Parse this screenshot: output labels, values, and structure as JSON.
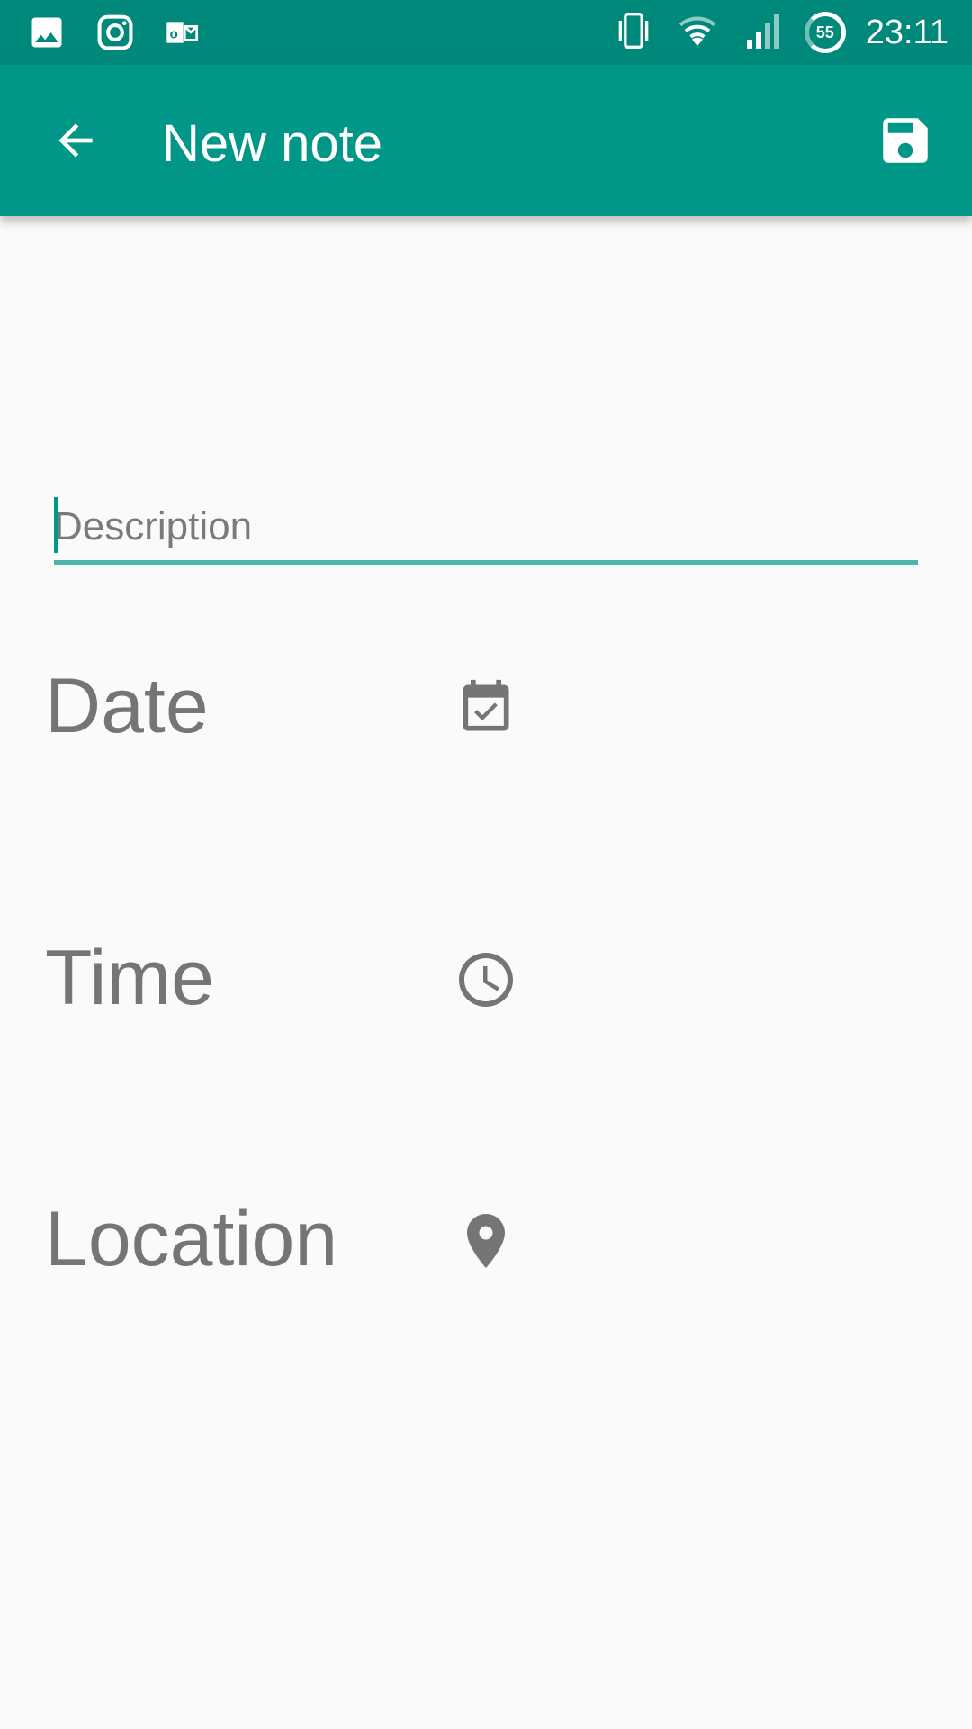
{
  "status_bar": {
    "time": "23:11",
    "battery_percent": "55",
    "left_icons": [
      "gallery-icon",
      "instagram-icon",
      "outlook-icon"
    ],
    "right_icons": [
      "vibrate-icon",
      "wifi-icon",
      "signal-icon",
      "battery-icon"
    ]
  },
  "app_bar": {
    "title": "New note",
    "back_icon": "arrow-back-icon",
    "save_icon": "save-icon"
  },
  "form": {
    "description_placeholder": "Description",
    "description_value": "",
    "date_label": "Date",
    "time_label": "Time",
    "location_label": "Location"
  },
  "colors": {
    "status_bar": "#00897b",
    "app_bar": "#009688",
    "accent": "#4db6ac",
    "label_gray": "#757575",
    "background": "#fafafa"
  }
}
